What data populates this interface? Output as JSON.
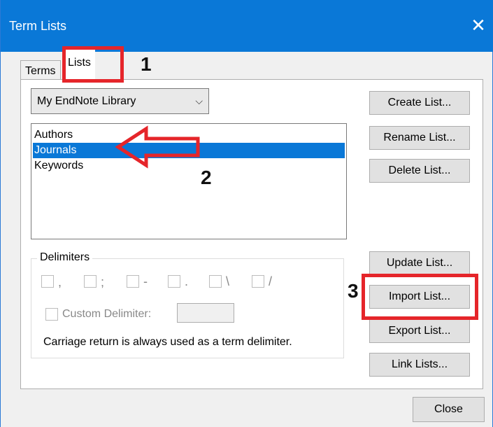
{
  "window": {
    "title": "Term Lists",
    "close_icon": "✕"
  },
  "tabs": {
    "terms": "Terms",
    "lists": "Lists"
  },
  "library_select": {
    "selected": "My EndNote Library",
    "chevron": "⌵"
  },
  "lists": {
    "items": [
      "Authors",
      "Journals",
      "Keywords"
    ],
    "selected_index": 1
  },
  "buttons": {
    "create": "Create List...",
    "rename": "Rename List...",
    "delete": "Delete List...",
    "update": "Update List...",
    "import": "Import List...",
    "export": "Export List...",
    "link": "Link Lists...",
    "close": "Close"
  },
  "delimiters": {
    "legend": "Delimiters",
    "options": [
      ",",
      ";",
      "-",
      ".",
      "\\",
      "/"
    ],
    "custom_label": "Custom Delimiter:",
    "custom_value": "",
    "note": "Carriage return is always used as a term delimiter."
  },
  "annotations": {
    "step1": "1",
    "step2": "2",
    "step3": "3"
  },
  "colors": {
    "titlebar": "#0a78d7",
    "annotation_red": "#e5252a",
    "selection": "#0a78d7"
  }
}
